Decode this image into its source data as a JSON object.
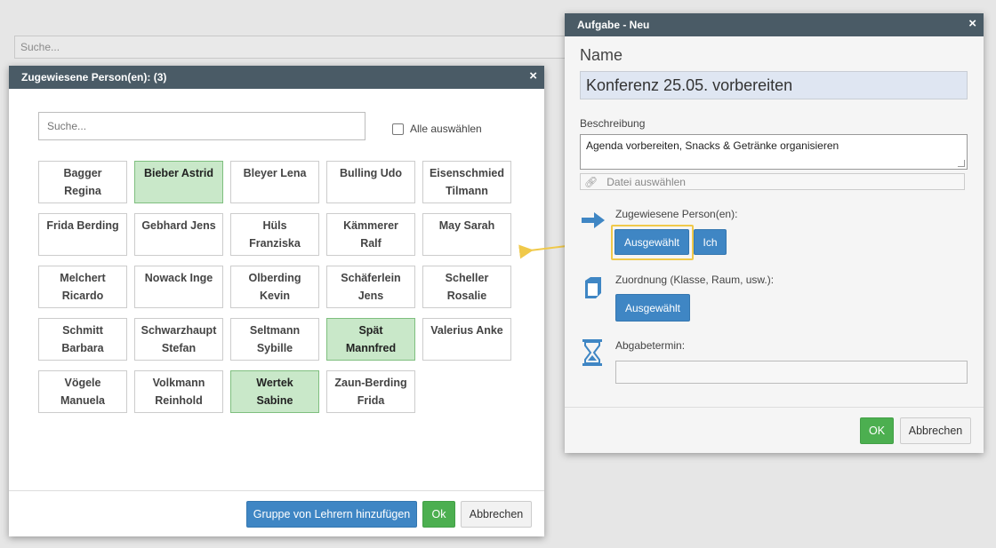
{
  "background": {
    "search_placeholder": "Suche..."
  },
  "person_dialog": {
    "title": "Zugewiesene Person(en): (3)",
    "close_icon": "×",
    "search_placeholder": "Suche...",
    "select_all_label": "Alle auswählen",
    "persons": [
      {
        "name": "Bagger\nRegina",
        "selected": false
      },
      {
        "name": "Bieber Astrid",
        "selected": true
      },
      {
        "name": "Bleyer Lena",
        "selected": false
      },
      {
        "name": "Bulling Udo",
        "selected": false
      },
      {
        "name": "Eisenschmied\nTilmann",
        "selected": false
      },
      {
        "name": "Frida Berding",
        "selected": false
      },
      {
        "name": "Gebhard Jens",
        "selected": false
      },
      {
        "name": "Hüls\nFranziska",
        "selected": false
      },
      {
        "name": "Kämmerer\nRalf",
        "selected": false
      },
      {
        "name": "May Sarah",
        "selected": false
      },
      {
        "name": "Melchert\nRicardo",
        "selected": false
      },
      {
        "name": "Nowack Inge",
        "selected": false
      },
      {
        "name": "Olberding\nKevin",
        "selected": false
      },
      {
        "name": "Schäferlein\nJens",
        "selected": false
      },
      {
        "name": "Scheller\nRosalie",
        "selected": false
      },
      {
        "name": "Schmitt\nBarbara",
        "selected": false
      },
      {
        "name": "Schwarzhaupt\nStefan",
        "selected": false
      },
      {
        "name": "Seltmann\nSybille",
        "selected": false
      },
      {
        "name": "Spät\nMannfred",
        "selected": true
      },
      {
        "name": "Valerius Anke",
        "selected": false
      },
      {
        "name": "Vögele\nManuela",
        "selected": false
      },
      {
        "name": "Volkmann\nReinhold",
        "selected": false
      },
      {
        "name": "Wertek\nSabine",
        "selected": true
      },
      {
        "name": "Zaun-Berding\nFrida",
        "selected": false
      }
    ],
    "footer": {
      "add_group_label": "Gruppe von Lehrern hinzufügen",
      "ok_label": "Ok",
      "cancel_label": "Abbrechen"
    }
  },
  "task_dialog": {
    "title": "Aufgabe - Neu",
    "close_icon": "×",
    "name_label": "Name",
    "name_value": "Konferenz 25.05. vorbereiten",
    "description_label": "Beschreibung",
    "description_value": "Agenda vorbereiten, Snacks & Getränke organisieren",
    "file_placeholder": "Datei auswählen",
    "assigned_label": "Zugewiesene Person(en):",
    "assigned_selected_label": "Ausgewählt",
    "assigned_me_label": "Ich",
    "assignment_label": "Zuordnung (Klasse, Raum, usw.):",
    "assignment_selected_label": "Ausgewählt",
    "deadline_label": "Abgabetermin:",
    "deadline_value": "",
    "ok_label": "OK",
    "cancel_label": "Abbrechen"
  },
  "colors": {
    "header": "#4a5b66",
    "selected_person": "#c9e8c9",
    "primary": "#3f86c4",
    "success": "#4caf50",
    "highlight": "#f0c94a",
    "icon_blue": "#3f86c4"
  }
}
